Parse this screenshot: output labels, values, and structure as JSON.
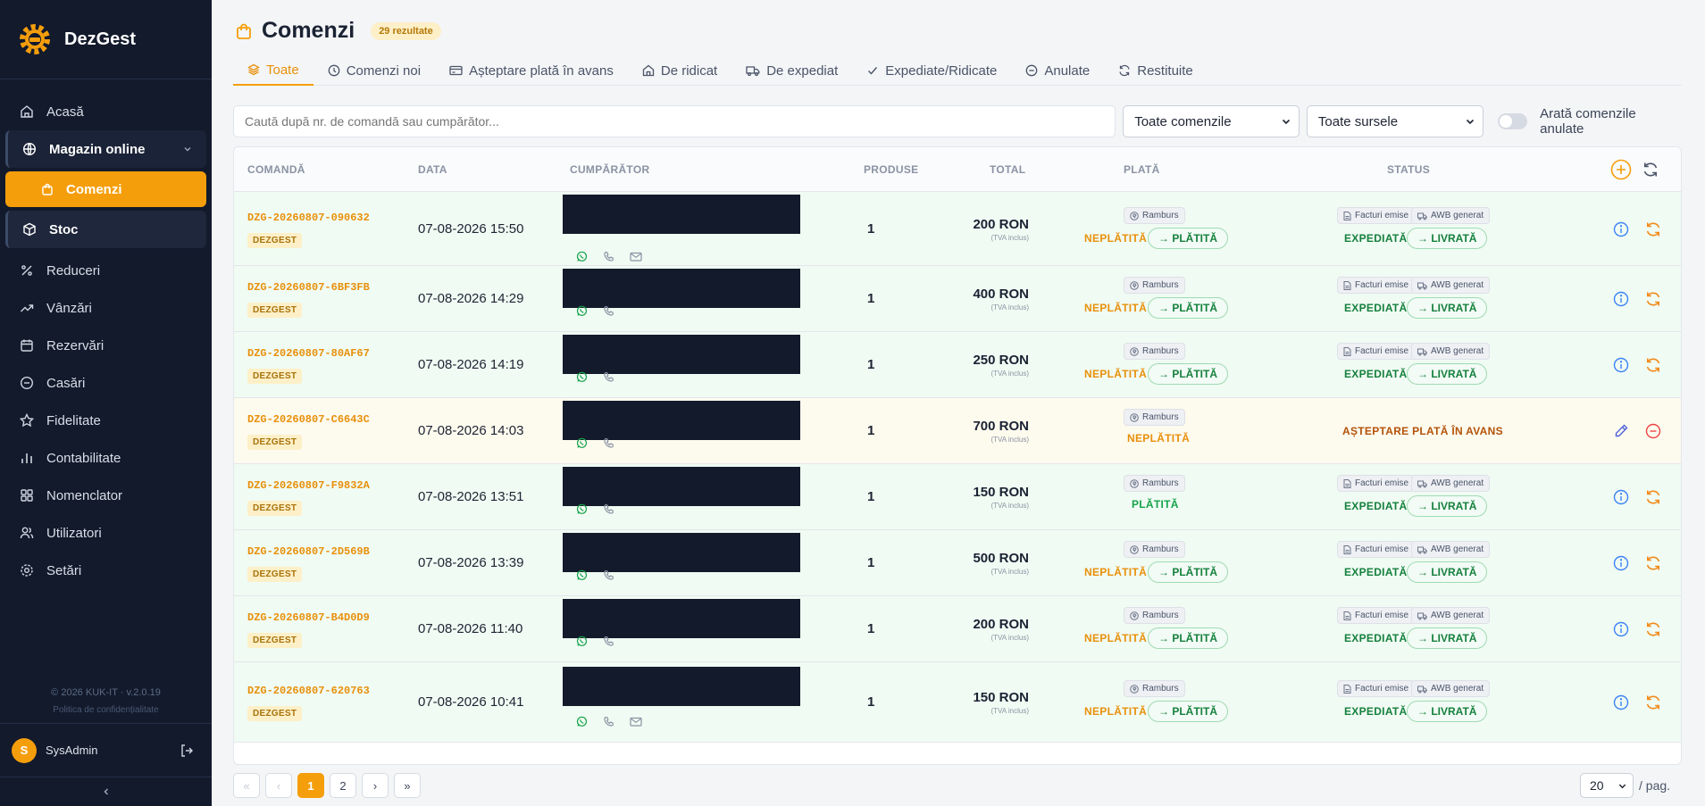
{
  "app": {
    "name": "DezGest",
    "brand_color": "#f59e0b",
    "sidebar_bg": "#121a2c"
  },
  "sidebar": {
    "items": [
      {
        "label": "Acasă",
        "icon": "home-icon"
      },
      {
        "label": "Magazin online",
        "icon": "globe-icon"
      },
      {
        "label": "Comenzi",
        "icon": "shopping-bag-icon"
      },
      {
        "label": "Stoc",
        "icon": "box-icon"
      },
      {
        "label": "Reduceri",
        "icon": "percent-icon"
      },
      {
        "label": "Vânzări",
        "icon": "trending-up-icon"
      },
      {
        "label": "Rezervări",
        "icon": "calendar-icon"
      },
      {
        "label": "Casări",
        "icon": "minus-circle-icon"
      },
      {
        "label": "Fidelitate",
        "icon": "star-icon"
      },
      {
        "label": "Contabilitate",
        "icon": "bar-chart-icon"
      },
      {
        "label": "Nomenclator",
        "icon": "grid-icon"
      },
      {
        "label": "Utilizatori",
        "icon": "users-icon"
      },
      {
        "label": "Setări",
        "icon": "gear-icon"
      }
    ],
    "footer": {
      "copyright": "© 2026 KUK-IT · v.2.0.19",
      "policy": "Politica de confidențialitate"
    },
    "user": {
      "initial": "S",
      "name": "SysAdmin"
    }
  },
  "page": {
    "title": "Comenzi",
    "count": "29 rezultate"
  },
  "tabs": [
    {
      "label": "Toate",
      "icon": "layers-icon"
    },
    {
      "label": "Comenzi noi",
      "icon": "clock-icon"
    },
    {
      "label": "Așteptare plată în avans",
      "icon": "credit-card-icon"
    },
    {
      "label": "De ridicat",
      "icon": "store-icon"
    },
    {
      "label": "De expediat",
      "icon": "truck-icon"
    },
    {
      "label": "Expediate/Ridicate",
      "icon": "check-icon"
    },
    {
      "label": "Anulate",
      "icon": "minus-circle-icon"
    },
    {
      "label": "Restituite",
      "icon": "refresh-icon"
    }
  ],
  "filters": {
    "search_placeholder": "Caută după nr. de comandă sau cumpărător...",
    "orders_select": "Toate comenzile",
    "sources_select": "Toate sursele",
    "toggle_label": "Arată comenzile anulate"
  },
  "table": {
    "headers": {
      "order": "COMANDĂ",
      "date": "DATA",
      "buyer": "CUMPĂRĂTOR",
      "products": "PRODUSE",
      "total": "TOTAL",
      "payment": "PLATĂ",
      "status": "STATUS"
    },
    "labels": {
      "vat": "(TVA inclus)",
      "method": "Ramburs",
      "invoices": "Facturi emise",
      "awb": "AWB generat",
      "mark_paid": "→ PLĂTITĂ",
      "mark_delivered": "→ LIVRATĂ"
    },
    "rows": [
      {
        "id": "DZG-20260807-090632",
        "source": "DEZGEST",
        "date": "07-08-2026 15:50",
        "products": "1",
        "total": "200 RON",
        "payment": "NEPLĂTITĂ",
        "status": "EXPEDIATĂ"
      },
      {
        "id": "DZG-20260807-6BF3FB",
        "source": "DEZGEST",
        "date": "07-08-2026 14:29",
        "products": "1",
        "total": "400 RON",
        "payment": "NEPLĂTITĂ",
        "status": "EXPEDIATĂ"
      },
      {
        "id": "DZG-20260807-80AF67",
        "source": "DEZGEST",
        "date": "07-08-2026 14:19",
        "products": "1",
        "total": "250 RON",
        "payment": "NEPLĂTITĂ",
        "status": "EXPEDIATĂ"
      },
      {
        "id": "DZG-20260807-C6643C",
        "source": "DEZGEST",
        "date": "07-08-2026 14:03",
        "products": "1",
        "total": "700 RON",
        "payment": "NEPLĂTITĂ",
        "status": "AȘTEPTARE PLATĂ ÎN AVANS"
      },
      {
        "id": "DZG-20260807-F9832A",
        "source": "DEZGEST",
        "date": "07-08-2026 13:51",
        "products": "1",
        "total": "150 RON",
        "payment": "PLĂTITĂ",
        "status": "EXPEDIATĂ"
      },
      {
        "id": "DZG-20260807-2D569B",
        "source": "DEZGEST",
        "date": "07-08-2026 13:39",
        "products": "1",
        "total": "500 RON",
        "payment": "NEPLĂTITĂ",
        "status": "EXPEDIATĂ"
      },
      {
        "id": "DZG-20260807-B4D0D9",
        "source": "DEZGEST",
        "date": "07-08-2026 11:40",
        "products": "1",
        "total": "200 RON",
        "payment": "NEPLĂTITĂ",
        "status": "EXPEDIATĂ"
      },
      {
        "id": "DZG-20260807-620763",
        "source": "DEZGEST",
        "date": "07-08-2026 10:41",
        "products": "1",
        "total": "150 RON",
        "payment": "NEPLĂTITĂ",
        "status": "EXPEDIATĂ"
      }
    ]
  },
  "pagination": {
    "pages": [
      "1",
      "2"
    ],
    "current": "1",
    "per_page": "20",
    "per_page_label": "/ pag."
  }
}
